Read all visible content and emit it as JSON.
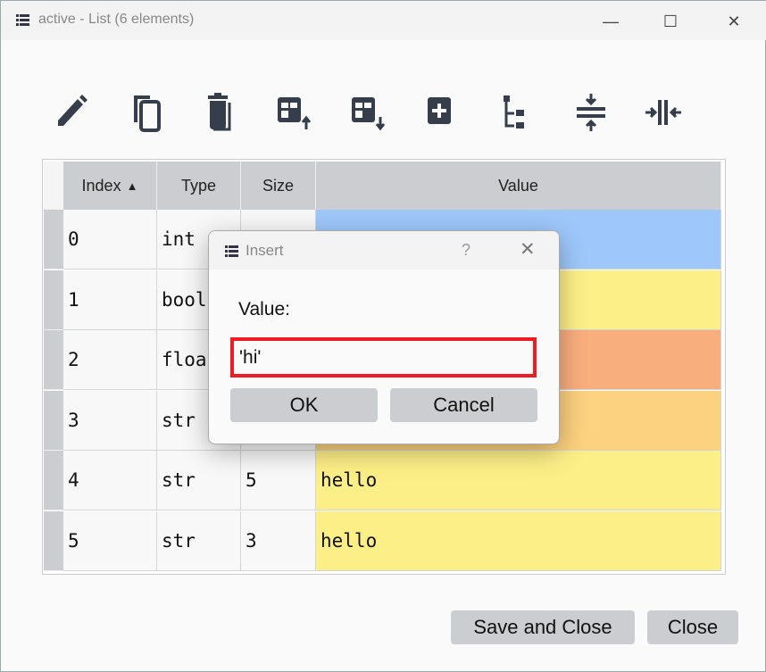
{
  "window": {
    "title": "active - List (6 elements)",
    "icon": "list-icon",
    "controls": [
      "minimize",
      "maximize",
      "close"
    ]
  },
  "toolbar": [
    {
      "name": "edit-icon"
    },
    {
      "name": "copy-icon"
    },
    {
      "name": "delete-icon"
    },
    {
      "name": "insert-above-icon"
    },
    {
      "name": "insert-below-icon"
    },
    {
      "name": "add-icon"
    },
    {
      "name": "tree-view-icon"
    },
    {
      "name": "collapse-icon"
    },
    {
      "name": "expand-icon"
    }
  ],
  "table": {
    "columns": [
      "Index",
      "Type",
      "Size",
      "Value"
    ],
    "sort": {
      "column": "Index",
      "direction": "ascending"
    },
    "rows": [
      {
        "index": "0",
        "type": "int",
        "size": "",
        "value": "",
        "color": "#9ec8fb"
      },
      {
        "index": "1",
        "type": "bool",
        "size": "",
        "value": "",
        "color": "#fdef87"
      },
      {
        "index": "2",
        "type": "float",
        "size": "",
        "value": "",
        "color": "#f9ae7e"
      },
      {
        "index": "3",
        "type": "str",
        "size": "",
        "value": "",
        "color": "#fcd17f"
      },
      {
        "index": "4",
        "type": "str",
        "size": "5",
        "value": "hello",
        "color": "#fdef87"
      },
      {
        "index": "5",
        "type": "str",
        "size": "3",
        "value": "hello",
        "color": "#fdef87"
      }
    ]
  },
  "dialog": {
    "title": "Insert",
    "help": "?",
    "label": "Value:",
    "input_value": "'hi'",
    "ok": "OK",
    "cancel": "Cancel",
    "focus_color": "#ee1c25"
  },
  "footer": {
    "save_close": "Save and Close",
    "close": "Close"
  }
}
